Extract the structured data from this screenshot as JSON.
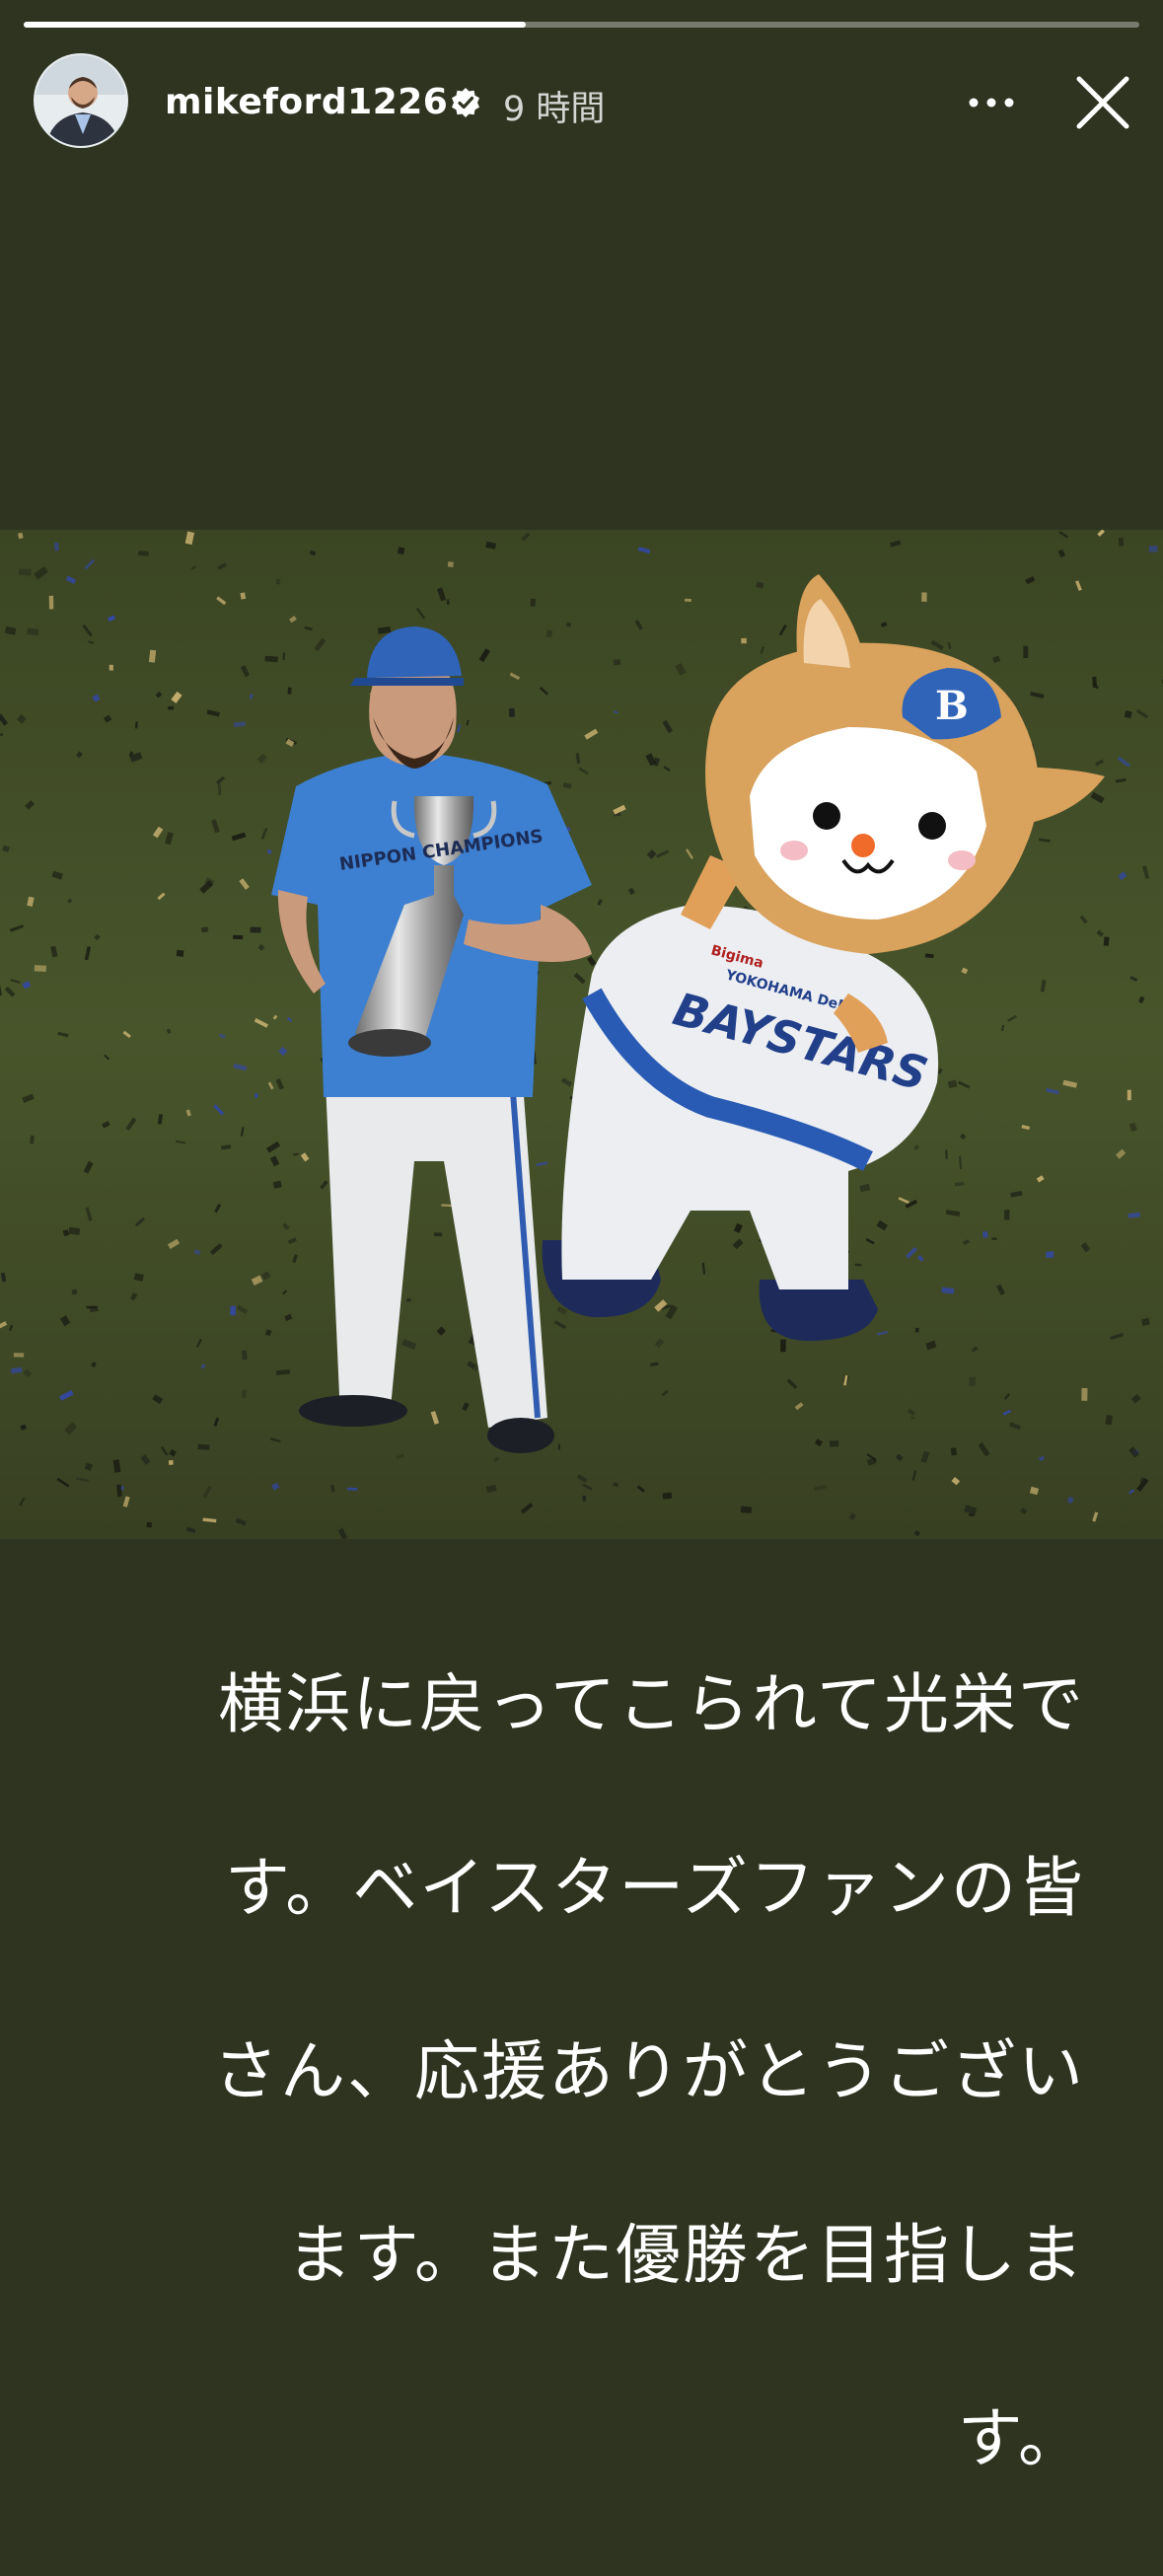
{
  "story": {
    "progress": 0.45,
    "username": "mikeford1226",
    "verified": true,
    "time_ago": "9 時間",
    "caption": "横浜に戻ってこられて光栄です。ベイスターズファンの皆さん、応援ありがとうございます。また優勝を目指します。",
    "caption_lines": [
      "横浜に戻ってこられて光栄で",
      "す。ベイスターズファンの皆",
      "さん、応援ありがとうござい",
      "ます。また優勝を目指しま",
      "す。"
    ]
  },
  "photo": {
    "cap_text": "NIPPON CHAMPIONS",
    "mascot_cap_letter": "B",
    "mascot_jersey_text": "BAYSTARS",
    "mascot_jersey_small": "YOKOHAMA DeNA",
    "sponsor_text": "Bigima"
  },
  "icons": {
    "verified": "verified-badge-icon",
    "more": "more-horizontal-icon",
    "close": "close-icon"
  },
  "colors": {
    "background": "#2e3420",
    "jersey_blue": "#3d7fd0",
    "turf": "#3f4a25"
  }
}
